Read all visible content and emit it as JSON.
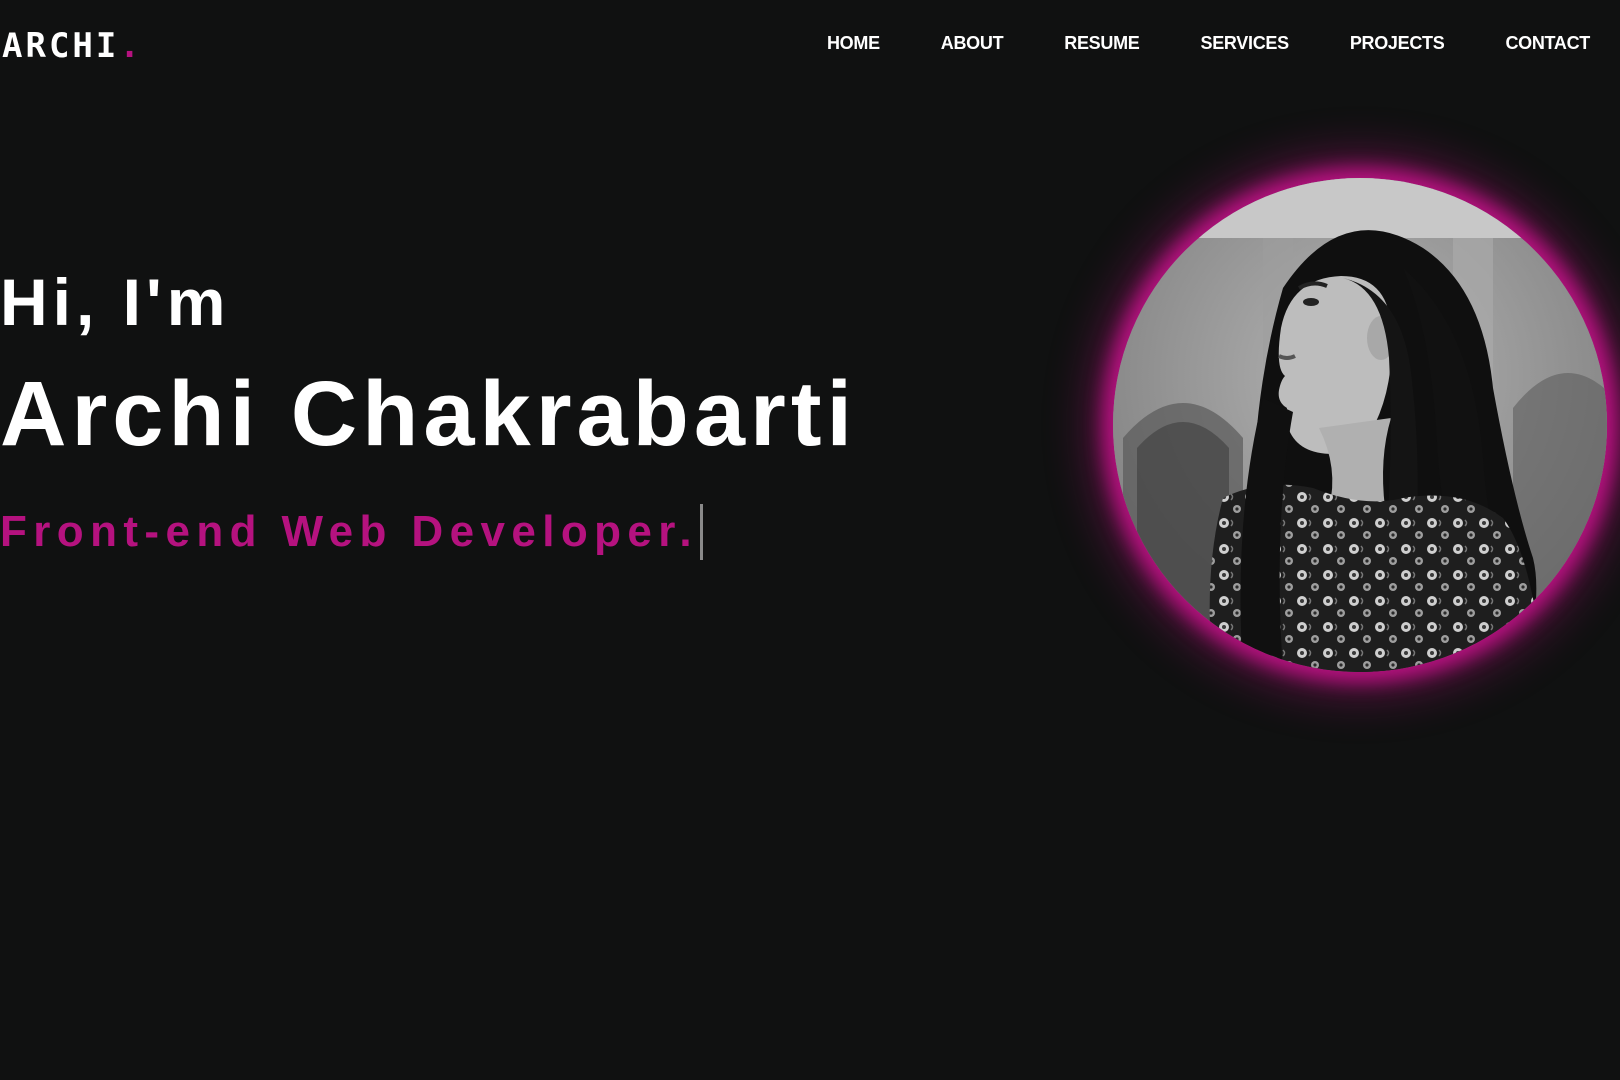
{
  "navbar": {
    "logo_text": "ARCHI",
    "logo_dot": ".",
    "links": [
      "HOME",
      "ABOUT",
      "RESUME",
      "SERVICES",
      "PROJECTS",
      "CONTACT"
    ]
  },
  "hero": {
    "greeting": "Hi, I'm",
    "name": "Archi Chakrabarti",
    "role": "Front-end Web Developer."
  },
  "colors": {
    "background": "#101111",
    "accent": "#b5127f",
    "text": "#ffffff"
  }
}
